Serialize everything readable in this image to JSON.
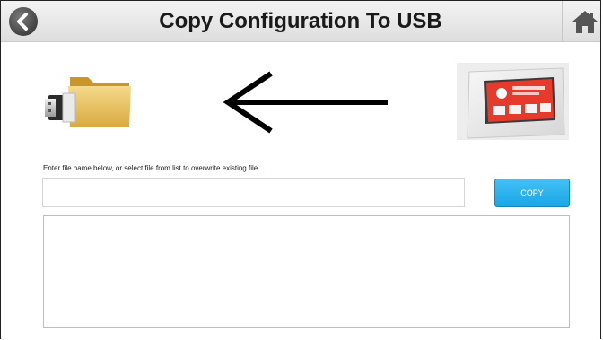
{
  "header": {
    "title": "Copy Configuration To USB"
  },
  "icons": {
    "back": "chevron-left-icon",
    "home": "home-icon",
    "usb_folder": "usb-folder-icon",
    "direction_arrow": "arrow-left-icon",
    "device_panel": "wall-panel-device-image"
  },
  "form": {
    "hint": "Enter file name below, or select file from list to overwrite existing file.",
    "filename_value": "",
    "copy_label": "COPY"
  },
  "file_list": {
    "items": []
  },
  "colors": {
    "accent": "#19a7e6",
    "header_bg": "#e6e6e6",
    "folder": "#e8c15d"
  }
}
